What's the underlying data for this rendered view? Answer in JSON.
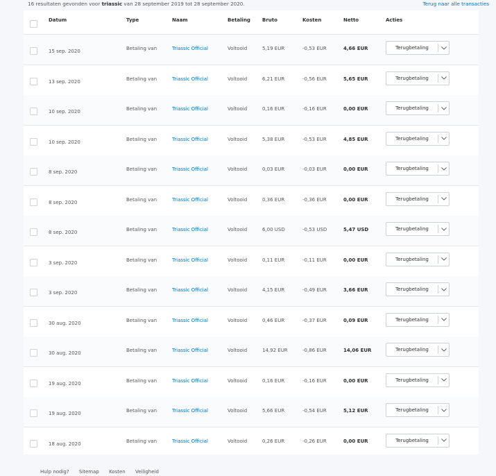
{
  "summary": {
    "prefix": "16 resultaten gevonden voor ",
    "query": "triassic",
    "suffix": " van 28 september 2019 tot 28 september 2020."
  },
  "back_link": "Terug naar alle transacties",
  "columns": {
    "date": "Datum",
    "type": "Type",
    "name": "Naam",
    "status": "Betaling",
    "gross": "Bruto",
    "fee": "Kosten",
    "net": "Netto",
    "actions": "Acties"
  },
  "action_label": "Terugbetaling",
  "icons": {
    "checkbox": "checkbox-icon",
    "dropdown": "chevron-down-icon"
  },
  "colors": {
    "link": "#0070ba",
    "background": "#f5f7fa",
    "border": "#e6e6e6"
  },
  "rows": [
    {
      "date": "15 sep. 2020",
      "type": "Betaling van",
      "name": "Triassic Official",
      "status": "Voltooid",
      "gross": "5,19 EUR",
      "fee": "-0,53 EUR",
      "net": "4,66 EUR"
    },
    {
      "date": "13 sep. 2020",
      "type": "Betaling van",
      "name": "Triassic Official",
      "status": "Voltooid",
      "gross": "6,21 EUR",
      "fee": "-0,56 EUR",
      "net": "5,65 EUR"
    },
    {
      "date": "10 sep. 2020",
      "type": "Betaling van",
      "name": "Triassic Official",
      "status": "Voltooid",
      "gross": "0,16 EUR",
      "fee": "-0,16 EUR",
      "net": "0,00 EUR"
    },
    {
      "date": "10 sep. 2020",
      "type": "Betaling van",
      "name": "Triassic Official",
      "status": "Voltooid",
      "gross": "5,38 EUR",
      "fee": "-0,53 EUR",
      "net": "4,85 EUR"
    },
    {
      "date": "8 sep. 2020",
      "type": "Betaling van",
      "name": "Triassic Official",
      "status": "Voltooid",
      "gross": "0,03 EUR",
      "fee": "-0,03 EUR",
      "net": "0,00 EUR"
    },
    {
      "date": "8 sep. 2020",
      "type": "Betaling van",
      "name": "Triassic Official",
      "status": "Voltooid",
      "gross": "0,36 EUR",
      "fee": "-0,36 EUR",
      "net": "0,00 EUR"
    },
    {
      "date": "8 sep. 2020",
      "type": "Betaling van",
      "name": "Triassic Official",
      "status": "Voltooid",
      "gross": "6,00 USD",
      "fee": "-0,53 USD",
      "net": "5,47 USD"
    },
    {
      "date": "3 sep. 2020",
      "type": "Betaling van",
      "name": "Triassic Official",
      "status": "Voltooid",
      "gross": "0,11 EUR",
      "fee": "-0,11 EUR",
      "net": "0,00 EUR"
    },
    {
      "date": "3 sep. 2020",
      "type": "Betaling van",
      "name": "Triassic Official",
      "status": "Voltooid",
      "gross": "4,15 EUR",
      "fee": "-0,49 EUR",
      "net": "3,66 EUR"
    },
    {
      "date": "30 aug. 2020",
      "type": "Betaling van",
      "name": "Triassic Official",
      "status": "Voltooid",
      "gross": "0,46 EUR",
      "fee": "-0,37 EUR",
      "net": "0,09 EUR"
    },
    {
      "date": "30 aug. 2020",
      "type": "Betaling van",
      "name": "Triassic Official",
      "status": "Voltooid",
      "gross": "14,92 EUR",
      "fee": "-0,86 EUR",
      "net": "14,06 EUR"
    },
    {
      "date": "19 aug. 2020",
      "type": "Betaling van",
      "name": "Triassic Official",
      "status": "Voltooid",
      "gross": "0,16 EUR",
      "fee": "-0,16 EUR",
      "net": "0,00 EUR"
    },
    {
      "date": "19 aug. 2020",
      "type": "Betaling van",
      "name": "Triassic Official",
      "status": "Voltooid",
      "gross": "5,66 EUR",
      "fee": "-0,54 EUR",
      "net": "5,12 EUR"
    },
    {
      "date": "18 aug. 2020",
      "type": "Betaling van",
      "name": "Triassic Official",
      "status": "Voltooid",
      "gross": "0,26 EUR",
      "fee": "-0,26 EUR",
      "net": "0,00 EUR"
    }
  ],
  "footer": {
    "links": [
      "Hulp nodig?",
      "Sitemap",
      "Kosten",
      "Veiligheid"
    ]
  }
}
